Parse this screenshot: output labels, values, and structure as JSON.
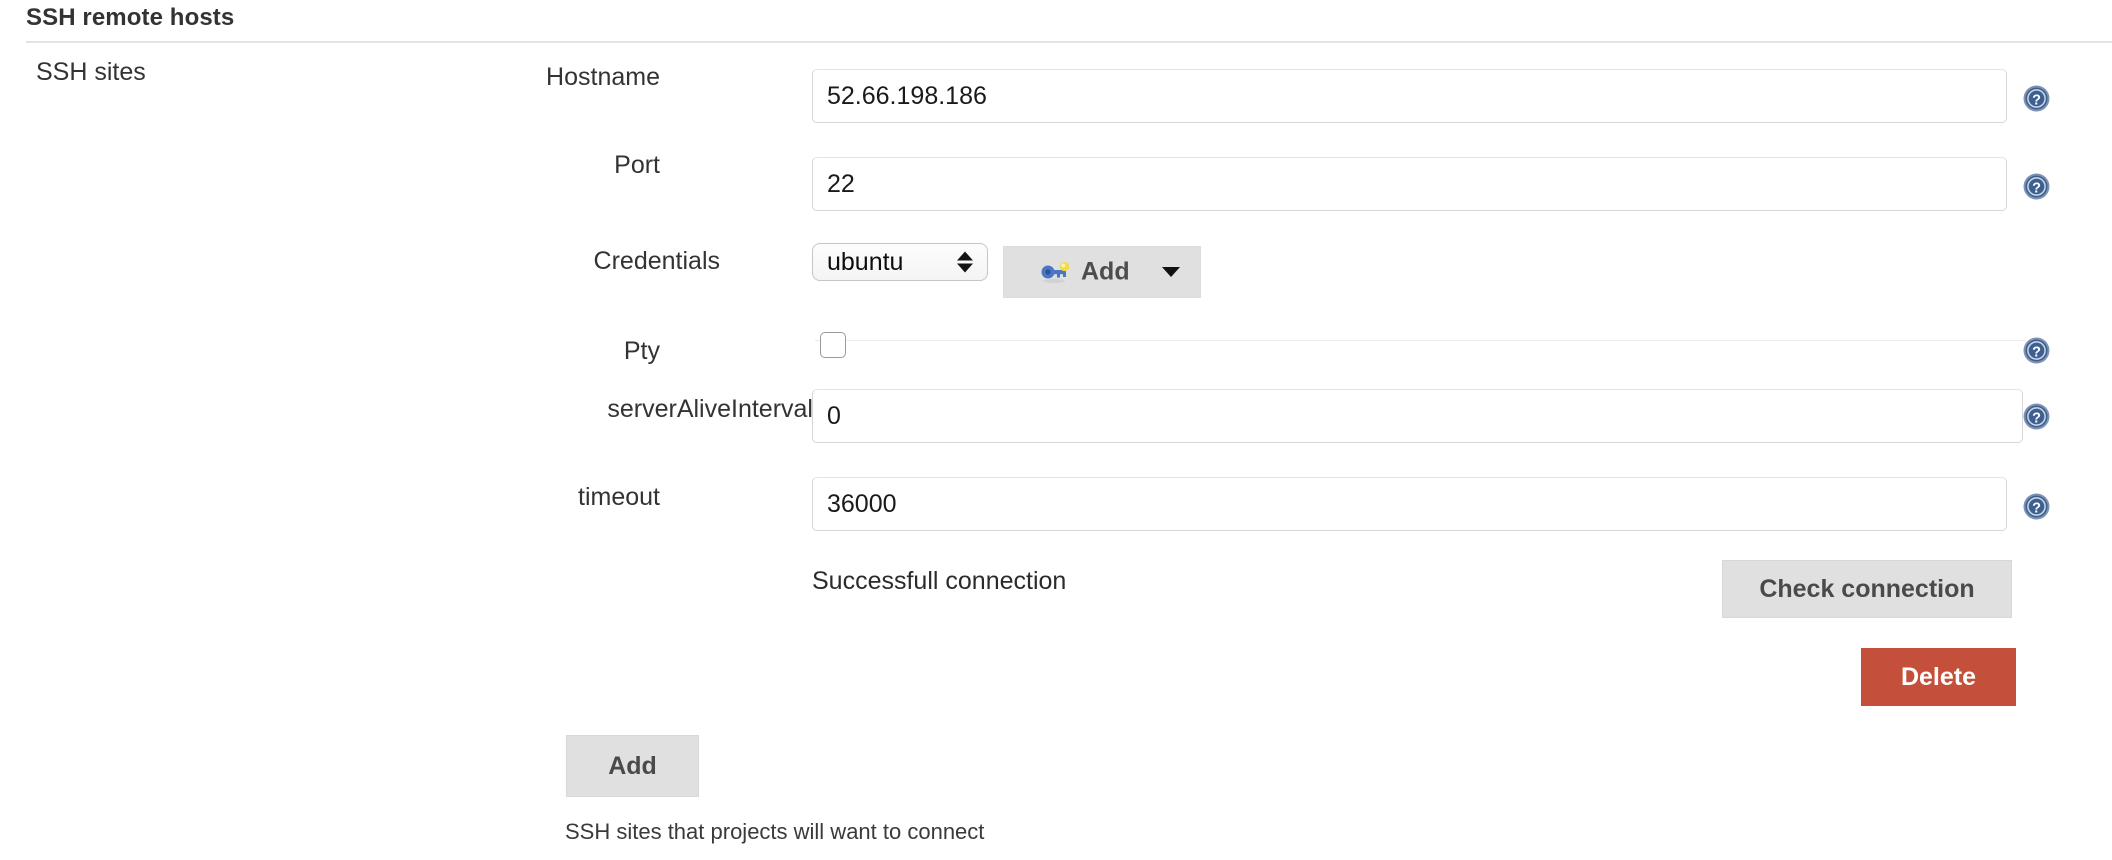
{
  "header": {
    "title": "SSH remote hosts"
  },
  "sidebar": {
    "group_label": "SSH sites"
  },
  "form": {
    "hostname": {
      "label": "Hostname",
      "value": "52.66.198.186",
      "help_icon": "help-circle-icon"
    },
    "port": {
      "label": "Port",
      "value": "22",
      "help_icon": "help-circle-icon"
    },
    "credentials": {
      "label": "Credentials",
      "selected": "ubuntu",
      "options": [
        "ubuntu"
      ],
      "add_button_label": "Add",
      "add_button_icon": "key-icon",
      "add_button_caret": "chevron-down-icon"
    },
    "pty": {
      "label": "Pty",
      "checked": false,
      "help_icon": "help-circle-icon"
    },
    "server_alive_interval": {
      "label": "serverAliveInterval",
      "value": "0",
      "help_icon": "help-circle-icon"
    },
    "timeout": {
      "label": "timeout",
      "value": "36000",
      "help_icon": "help-circle-icon"
    }
  },
  "status": {
    "message": "Successfull connection"
  },
  "actions": {
    "check_connection_label": "Check connection",
    "delete_label": "Delete",
    "add_site_label": "Add"
  },
  "footer": {
    "description": "SSH sites that projects will want to connect"
  },
  "colors": {
    "delete_button": "#c4503c",
    "grey_button": "#e0e0e0",
    "help_icon": "#3b5a8c",
    "text": "#333333",
    "border": "#d6d6d6"
  }
}
